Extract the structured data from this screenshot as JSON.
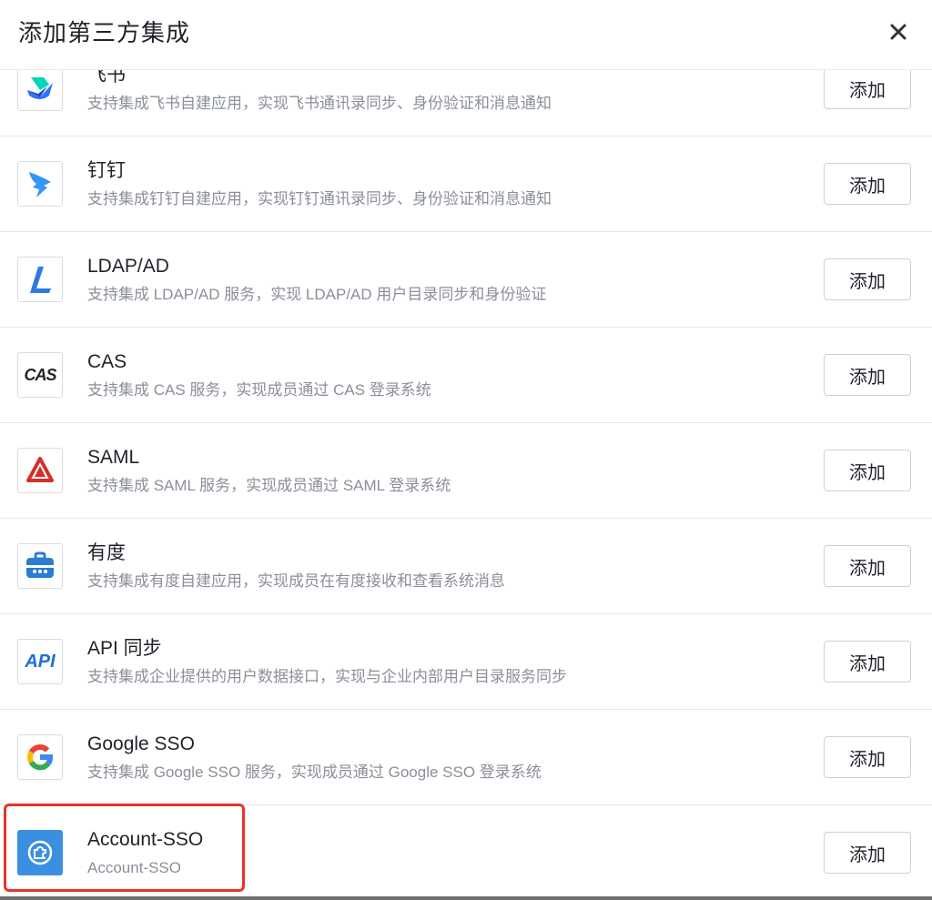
{
  "dialog": {
    "title": "添加第三方集成",
    "close_icon": "close-icon"
  },
  "integrations": [
    {
      "name": "飞书",
      "desc": "支持集成飞书自建应用，实现飞书通讯录同步、身份验证和消息通知",
      "button": "添加",
      "icon": "feishu-logo"
    },
    {
      "name": "钉钉",
      "desc": "支持集成钉钉自建应用，实现钉钉通讯录同步、身份验证和消息通知",
      "button": "添加",
      "icon": "dingtalk-logo"
    },
    {
      "name": "LDAP/AD",
      "desc": "支持集成 LDAP/AD 服务，实现 LDAP/AD 用户目录同步和身份验证",
      "button": "添加",
      "icon": "ldap-logo"
    },
    {
      "name": "CAS",
      "desc": "支持集成 CAS 服务，实现成员通过 CAS 登录系统",
      "button": "添加",
      "icon": "cas-logo",
      "logo_text": "CAS"
    },
    {
      "name": "SAML",
      "desc": "支持集成 SAML 服务，实现成员通过 SAML 登录系统",
      "button": "添加",
      "icon": "saml-logo"
    },
    {
      "name": "有度",
      "desc": "支持集成有度自建应用，实现成员在有度接收和查看系统消息",
      "button": "添加",
      "icon": "youdu-logo"
    },
    {
      "name": "API 同步",
      "desc": "支持集成企业提供的用户数据接口，实现与企业内部用户目录服务同步",
      "button": "添加",
      "icon": "api-logo",
      "logo_text": "API"
    },
    {
      "name": "Google SSO",
      "desc": "支持集成 Google SSO 服务，实现成员通过 Google SSO 登录系统",
      "button": "添加",
      "icon": "google-logo"
    },
    {
      "name": "Account-SSO",
      "desc": "Account-SSO",
      "button": "添加",
      "icon": "account-sso-logo"
    }
  ],
  "colors": {
    "highlight": "#e8332a",
    "feishu_blue": "#3370ff",
    "feishu_teal": "#00d6b9",
    "dingtalk_blue": "#3296fa",
    "ldap_blue": "#2c7be5",
    "saml_red": "#d0312d",
    "youdu_blue": "#2b7cd3",
    "api_blue": "#1e6fd9",
    "account_sso_bg": "#3b8fe0"
  }
}
